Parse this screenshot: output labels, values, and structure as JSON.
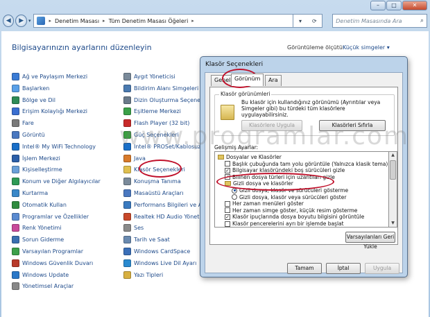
{
  "window": {
    "address_path": [
      "Denetim Masası",
      "Tüm Denetim Masası Öğeleri"
    ],
    "search_placeholder": "Denetim Masasında Ara",
    "controls": {
      "minimize": "–",
      "maximize": "□",
      "close": "✕"
    }
  },
  "control_panel": {
    "title": "Bilgisayarınızın ayarlarını düzenleyin",
    "view_by_label": "Görüntüleme ölçütü:",
    "view_by_value": "Küçük simgeler ▾",
    "column1": [
      {
        "label": "Ağ ve Paylaşım Merkezi",
        "color": "#3a7bd5"
      },
      {
        "label": "Başlarken",
        "color": "#59a0e8"
      },
      {
        "label": "Bölge ve Dil",
        "color": "#2e8b57"
      },
      {
        "label": "Erişim Kolaylığı Merkezi",
        "color": "#3a6fd0"
      },
      {
        "label": "Fare",
        "color": "#7a7a7a"
      },
      {
        "label": "Görüntü",
        "color": "#4a78c0"
      },
      {
        "label": "Intel® My WiFi Technology",
        "color": "#1a6fc8"
      },
      {
        "label": "İşlem Merkezi",
        "color": "#2b5fa8"
      },
      {
        "label": "Kişiselleştirme",
        "color": "#6aa0d8"
      },
      {
        "label": "Konum ve Diğer Algılayıcılar",
        "color": "#2e9a55"
      },
      {
        "label": "Kurtarma",
        "color": "#3a88c8"
      },
      {
        "label": "Otomatik Kullan",
        "color": "#2f8c3f"
      },
      {
        "label": "Programlar ve Özellikler",
        "color": "#5a8ad0"
      },
      {
        "label": "Renk Yönetimi",
        "color": "#c84a9a"
      },
      {
        "label": "Sorun Giderme",
        "color": "#3a6fb0"
      },
      {
        "label": "Varsayılan Programlar",
        "color": "#3ca04a"
      },
      {
        "label": "Windows Güvenlik Duvarı",
        "color": "#b83a2a"
      },
      {
        "label": "Windows Update",
        "color": "#2a78c8"
      },
      {
        "label": "Yönetimsel Araçlar",
        "color": "#888888"
      }
    ],
    "column2": [
      {
        "label": "Aygıt Yöneticisi",
        "color": "#7a8a9a"
      },
      {
        "label": "Bildirim Alanı Simgeleri",
        "color": "#4a7ab0"
      },
      {
        "label": "Dizin Oluşturma Seçenekle",
        "color": "#6a7a8a"
      },
      {
        "label": "Eşitleme Merkezi",
        "color": "#3aa048"
      },
      {
        "label": "Flash Player (32 bit)",
        "color": "#c82a2a"
      },
      {
        "label": "Güç Seçenekleri",
        "color": "#3aa040"
      },
      {
        "label": "Intel® PROSet/Kablosuz",
        "color": "#1a6fc8"
      },
      {
        "label": "Java",
        "color": "#d87a2a"
      },
      {
        "label": "Klasör Seçenekleri",
        "color": "#e0c050"
      },
      {
        "label": "Konuşma Tanıma",
        "color": "#7a8a9a"
      },
      {
        "label": "Masaüstü Araçları",
        "color": "#4a78c0"
      },
      {
        "label": "Performans Bilgileri ve Araç",
        "color": "#3a7ac0"
      },
      {
        "label": "Realtek HD Audio Yönetici",
        "color": "#c8482a"
      },
      {
        "label": "Ses",
        "color": "#8a8a8a"
      },
      {
        "label": "Tarih ve Saat",
        "color": "#6a8ab0"
      },
      {
        "label": "Windows CardSpace",
        "color": "#3a6fb8"
      },
      {
        "label": "Windows Live Dil Ayarı",
        "color": "#2a8ad0"
      },
      {
        "label": "Yazı Tipleri",
        "color": "#d8b040"
      }
    ]
  },
  "dialog": {
    "title": "Klasör Seçenekleri",
    "tabs": [
      "Genel",
      "Görünüm",
      "Ara"
    ],
    "active_tab": "Görünüm",
    "folder_views": {
      "label": "Klasör görünümleri",
      "description": "Bu klasör için kullandığınız görünümü (Ayrıntılar veya Simgeler gibi) bu türdeki tüm klasörlere uygulayabilirsiniz.",
      "apply_button": "Klasörlere Uygula",
      "reset_button": "Klasörleri Sıfırla"
    },
    "advanced_label": "Gelişmiş Ayarlar:",
    "settings": [
      {
        "kind": "folder",
        "label": "Dosyalar ve Klasörler",
        "level": 0
      },
      {
        "kind": "check",
        "label": "Başlık çubuğunda tam yolu görüntüle (Yalnızca klasik tema)",
        "checked": false,
        "level": 1
      },
      {
        "kind": "check",
        "label": "Bilgisayar klasöründeki boş sürücüleri gizle",
        "checked": true,
        "level": 1
      },
      {
        "kind": "check",
        "label": "Bilinen dosya türleri için uzantıları gizle",
        "checked": true,
        "level": 1
      },
      {
        "kind": "folder",
        "label": "Gizli dosya ve klasörler",
        "level": 1
      },
      {
        "kind": "radio",
        "label": "Gizli dosya, klasör ve sürücüleri gösterme",
        "checked": true,
        "level": 2
      },
      {
        "kind": "radio",
        "label": "Gizli dosya, klasör veya sürücüleri göster",
        "checked": false,
        "level": 2
      },
      {
        "kind": "check",
        "label": "Her zaman menüleri göster",
        "checked": false,
        "level": 1
      },
      {
        "kind": "check",
        "label": "Her zaman simge göster, küçük resim gösterme",
        "checked": false,
        "level": 1
      },
      {
        "kind": "check",
        "label": "Klasör ipuçlarında dosya boyutu bilgisini görüntüle",
        "checked": true,
        "level": 1
      },
      {
        "kind": "check",
        "label": "Klasör pencerelerini ayrı bir işlemde başlat",
        "checked": false,
        "level": 1
      }
    ],
    "restore_button": "Varsayılanları Geri Yükle",
    "ok_button": "Tamam",
    "cancel_button": "İptal",
    "apply_button": "Uygula"
  },
  "watermark": "www.programlar.com"
}
